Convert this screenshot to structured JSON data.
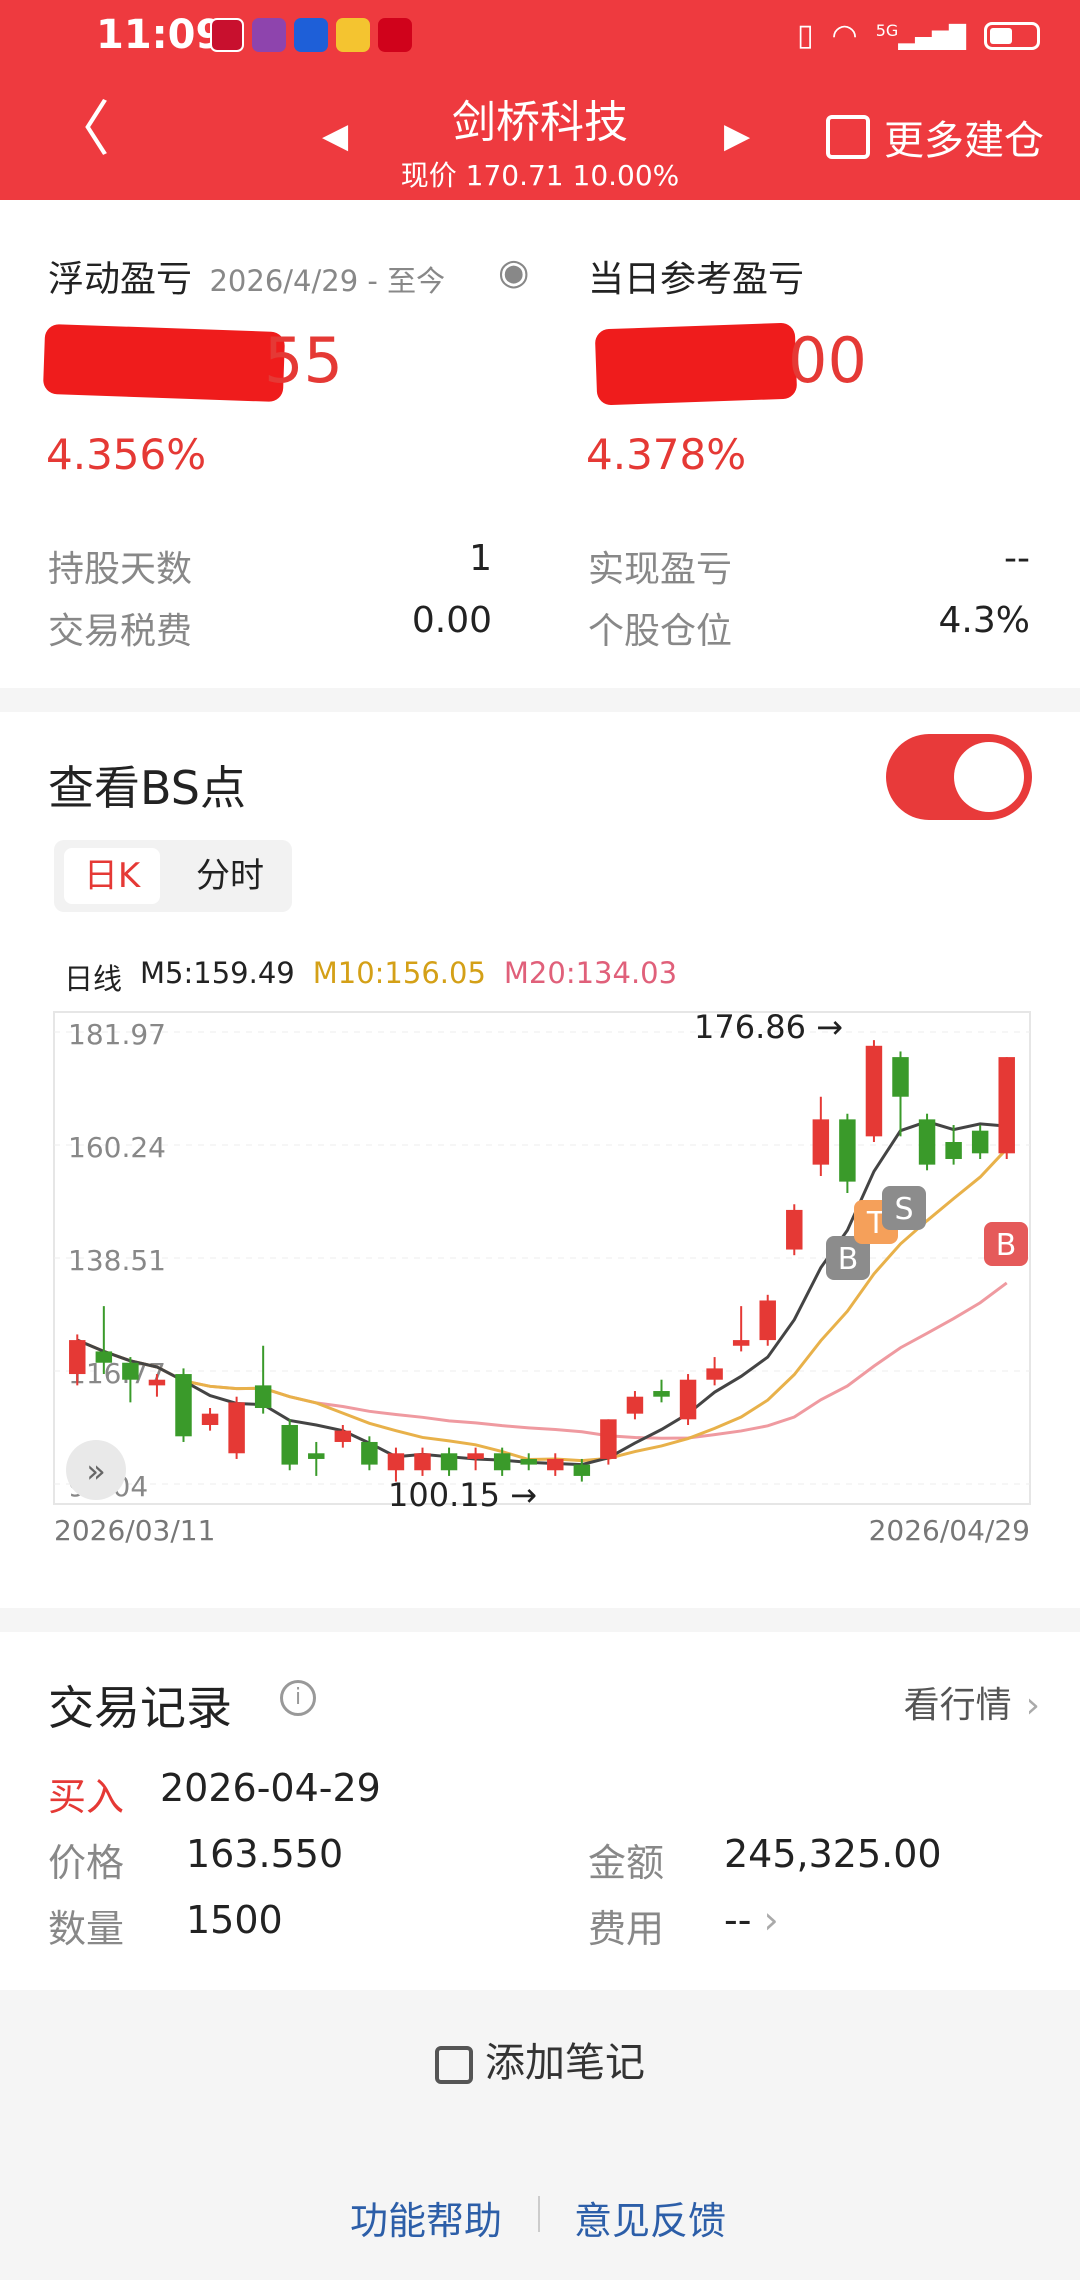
{
  "status_bar": {
    "time": "11:09",
    "network": "5G"
  },
  "header": {
    "stock_name": "剑桥科技",
    "price_label": "现价",
    "price": "170.71",
    "change_pct": "10.00%",
    "more_label": "更多建仓",
    "bg_color": "#ee3a3f"
  },
  "summary": {
    "floating_pl_label": "浮动盈亏",
    "date_range": "2026/4/29 - 至今",
    "floating_pl_value_visible": "55",
    "floating_pl_pct": "4.356%",
    "daily_ref_label": "当日参考盈亏",
    "daily_ref_value_visible": "00",
    "daily_ref_pct": "4.378%",
    "rows": [
      {
        "label": "持股天数",
        "value": "1"
      },
      {
        "label": "交易税费",
        "value": "0.00"
      },
      {
        "label": "实现盈亏",
        "value": "--"
      },
      {
        "label": "个股仓位",
        "value": "4.3%"
      }
    ]
  },
  "bs": {
    "title": "查看BS点",
    "toggle_on": true,
    "tabs": [
      "日K",
      "分时"
    ],
    "active_tab": "日K",
    "ma_line_label": "日线",
    "ma5": "M5:159.49",
    "ma10": "M10:156.05",
    "ma20": "M20:134.03",
    "colors": {
      "up": "#e53935",
      "down": "#3a9a2a",
      "ma5": "#444444",
      "ma10": "#e8b14a",
      "ma20": "#ef9aa0"
    }
  },
  "chart_data": {
    "type": "candlestick",
    "y_ticks": [
      "181.97",
      "160.24",
      "138.51",
      "116.77",
      "95.04"
    ],
    "ylim": [
      95.04,
      181.97
    ],
    "x_labels": [
      "2026/03/11",
      "2026/04/29"
    ],
    "high_annotation": "176.86",
    "low_annotation": "100.15",
    "markers": [
      "B",
      "T",
      "S",
      "B"
    ],
    "candles": [
      {
        "o": 118,
        "c": 124,
        "h": 125,
        "l": 116,
        "up": true
      },
      {
        "o": 122,
        "c": 120,
        "h": 130,
        "l": 118,
        "up": false
      },
      {
        "o": 120,
        "c": 117,
        "h": 121,
        "l": 113,
        "up": false
      },
      {
        "o": 117,
        "c": 116,
        "h": 118,
        "l": 114,
        "up": true
      },
      {
        "o": 118,
        "c": 107,
        "h": 119,
        "l": 106,
        "up": false
      },
      {
        "o": 109,
        "c": 111,
        "h": 112,
        "l": 108,
        "up": true
      },
      {
        "o": 104,
        "c": 113,
        "h": 114,
        "l": 103,
        "up": true
      },
      {
        "o": 112,
        "c": 116,
        "h": 123,
        "l": 111,
        "up": false
      },
      {
        "o": 109,
        "c": 102,
        "h": 110,
        "l": 101,
        "up": false
      },
      {
        "o": 104,
        "c": 103,
        "h": 106,
        "l": 100,
        "up": false
      },
      {
        "o": 108,
        "c": 106,
        "h": 109,
        "l": 105,
        "up": true
      },
      {
        "o": 106,
        "c": 102,
        "h": 107,
        "l": 101,
        "up": false
      },
      {
        "o": 101,
        "c": 104,
        "h": 105,
        "l": 99,
        "up": true
      },
      {
        "o": 101,
        "c": 104,
        "h": 105,
        "l": 100,
        "up": true
      },
      {
        "o": 104,
        "c": 101,
        "h": 105,
        "l": 100,
        "up": false
      },
      {
        "o": 103,
        "c": 104,
        "h": 105,
        "l": 101,
        "up": true
      },
      {
        "o": 104,
        "c": 101,
        "h": 105,
        "l": 100,
        "up": false
      },
      {
        "o": 103,
        "c": 102,
        "h": 104,
        "l": 101,
        "up": false
      },
      {
        "o": 101,
        "c": 103,
        "h": 104,
        "l": 100,
        "up": true
      },
      {
        "o": 102,
        "c": 100,
        "h": 103,
        "l": 99,
        "up": false
      },
      {
        "o": 103,
        "c": 110,
        "h": 110,
        "l": 102,
        "up": true
      },
      {
        "o": 111,
        "c": 114,
        "h": 115,
        "l": 110,
        "up": true
      },
      {
        "o": 115,
        "c": 114,
        "h": 117,
        "l": 113,
        "up": false
      },
      {
        "o": 110,
        "c": 117,
        "h": 118,
        "l": 109,
        "up": true
      },
      {
        "o": 117,
        "c": 119,
        "h": 121,
        "l": 116,
        "up": true
      },
      {
        "o": 123,
        "c": 124,
        "h": 130,
        "l": 122,
        "up": true
      },
      {
        "o": 124,
        "c": 131,
        "h": 132,
        "l": 123,
        "up": true
      },
      {
        "o": 140,
        "c": 147,
        "h": 148,
        "l": 139,
        "up": true
      },
      {
        "o": 155,
        "c": 163,
        "h": 167,
        "l": 153,
        "up": true
      },
      {
        "o": 163,
        "c": 152,
        "h": 164,
        "l": 150,
        "up": false
      },
      {
        "o": 160,
        "c": 176,
        "h": 177,
        "l": 159,
        "up": true
      },
      {
        "o": 174,
        "c": 167,
        "h": 175,
        "l": 160,
        "up": false
      },
      {
        "o": 163,
        "c": 155,
        "h": 164,
        "l": 154,
        "up": false
      },
      {
        "o": 159,
        "c": 156,
        "h": 162,
        "l": 155,
        "up": false
      },
      {
        "o": 161,
        "c": 157,
        "h": 162,
        "l": 156,
        "up": false
      },
      {
        "o": 157,
        "c": 174,
        "h": 174,
        "l": 156,
        "up": true
      }
    ]
  },
  "trades": {
    "title": "交易记录",
    "link_label": "看行情",
    "type": "买入",
    "date": "2026-04-29",
    "price_label": "价格",
    "price": "163.550",
    "amount_label": "金额",
    "amount": "245,325.00",
    "qty_label": "数量",
    "qty": "1500",
    "fee_label": "费用",
    "fee": "--"
  },
  "note": {
    "add_label": "添加笔记"
  },
  "footer": {
    "help": "功能帮助",
    "feedback": "意见反馈"
  }
}
